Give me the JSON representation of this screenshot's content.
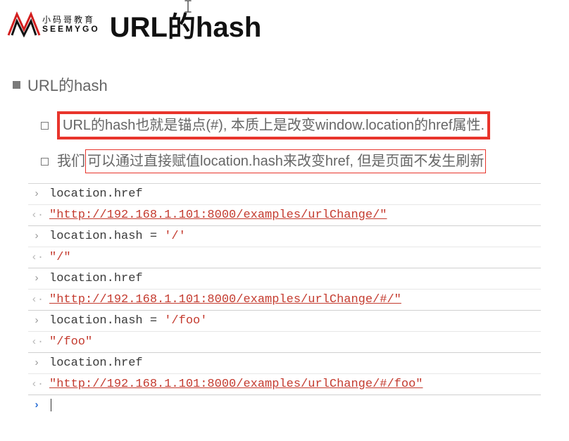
{
  "header": {
    "logo_cn": "小码哥教育",
    "logo_en": "SEEMYGO",
    "title": "URL的hash"
  },
  "section": {
    "heading": "URL的hash",
    "bullets": [
      {
        "text": "URL的hash也就是锚点(#), 本质上是改变window.location的href属性.",
        "highlight": "thick"
      },
      {
        "prefix": "我们",
        "text": "可以通过直接赋值location.hash来改变href, 但是页面不发生刷新",
        "highlight": "thin"
      }
    ]
  },
  "console": [
    {
      "dir": "in",
      "kind": "code",
      "text": "location.href"
    },
    {
      "dir": "out",
      "kind": "string_u",
      "text": "\"http://192.168.1.101:8000/examples/urlChange/\""
    },
    {
      "dir": "in",
      "kind": "code_assign",
      "lhs": "location.hash = ",
      "rhs": "'/'"
    },
    {
      "dir": "out",
      "kind": "string",
      "text": "\"/\""
    },
    {
      "dir": "in",
      "kind": "code",
      "text": "location.href"
    },
    {
      "dir": "out",
      "kind": "string_u",
      "text": "\"http://192.168.1.101:8000/examples/urlChange/#/\""
    },
    {
      "dir": "in",
      "kind": "code_assign",
      "lhs": "location.hash = ",
      "rhs": "'/foo'"
    },
    {
      "dir": "out",
      "kind": "string",
      "text": "\"/foo\""
    },
    {
      "dir": "in",
      "kind": "code",
      "text": "location.href"
    },
    {
      "dir": "out",
      "kind": "string_u",
      "text": "\"http://192.168.1.101:8000/examples/urlChange/#/foo\""
    }
  ]
}
